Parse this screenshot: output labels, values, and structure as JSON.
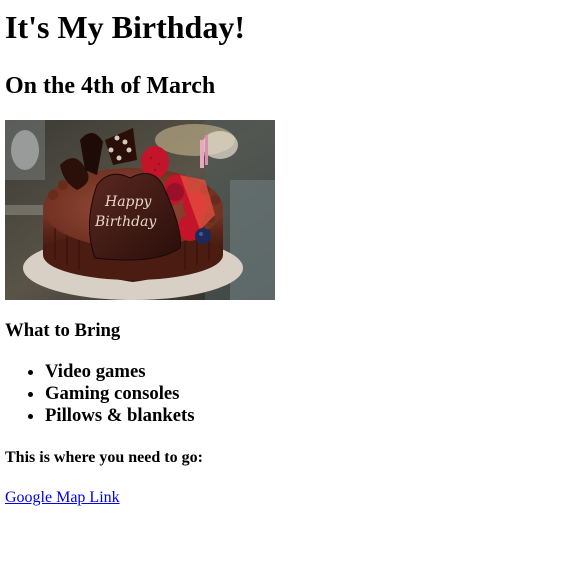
{
  "heading": "It's My Birthday!",
  "subheading": "On the 4th of March",
  "photo": {
    "alt": "Chocolate birthday cake with strawberries and a Happy Birthday chocolate heart",
    "cake_text_line1": "Happy",
    "cake_text_line2": "Birthday"
  },
  "bring_heading": "What to Bring",
  "bring_items": [
    "Video games",
    "Gaming consoles",
    "Pillows & blankets"
  ],
  "directions_heading": "This is where you need to go:",
  "map_link_text": "Google Map Link",
  "colors": {
    "link": "#0000ee",
    "text": "#000000",
    "background": "#ffffff"
  }
}
